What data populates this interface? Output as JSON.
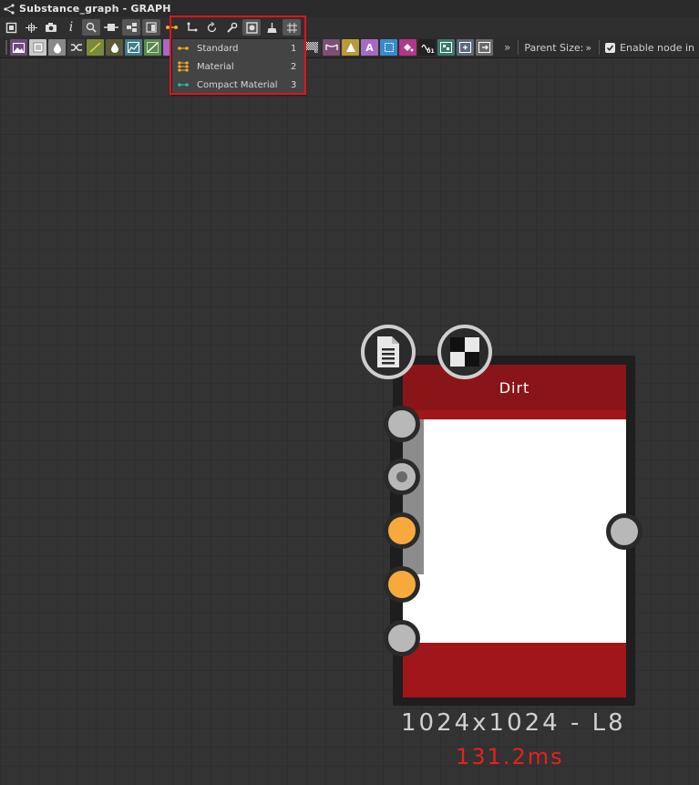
{
  "window": {
    "title": "Substance_graph - GRAPH"
  },
  "toolbar1": {
    "buttons": [
      {
        "name": "frame-all-icon"
      },
      {
        "name": "fit-view-icon"
      },
      {
        "name": "camera-icon"
      },
      {
        "name": "info-icon",
        "glyph": "i"
      },
      {
        "name": "search-icon"
      },
      {
        "name": "link-icon"
      },
      {
        "name": "align-icon"
      },
      {
        "name": "layout-icon"
      },
      {
        "name": "connector-style-icon"
      },
      {
        "name": "path-icon"
      },
      {
        "name": "refresh-icon"
      },
      {
        "name": "tools-icon"
      },
      {
        "name": "preview-icon"
      },
      {
        "name": "cleanup-icon"
      },
      {
        "name": "grid-snap-icon"
      }
    ]
  },
  "toolbar2": {
    "more_label": "»",
    "parent_size_label": "Parent Size:",
    "parent_size_chevron": "»",
    "enable_node_label": "Enable node in",
    "enable_node_checked": true,
    "text_button_label": "A",
    "bit_label": "01",
    "colors": {
      "image": "#6e4c7a",
      "uniform": "#c9c9c9",
      "gradient": "#7a8a3c",
      "levels": "#5a8a4a",
      "blend": "#3f7c8c",
      "text": "#a56ac3",
      "transform": "#3a8ac8",
      "warp": "#b2368c"
    }
  },
  "connector_menu": {
    "items": [
      {
        "label": "Standard",
        "shortcut": "1",
        "color": "#f0a823"
      },
      {
        "label": "Material",
        "shortcut": "2",
        "color": "#f0a823"
      },
      {
        "label": "Compact Material",
        "shortcut": "3",
        "color": "#2fb6a2"
      }
    ]
  },
  "node": {
    "title": "Dirt",
    "resolution": "1024x1024 - L8",
    "time": "131.2ms",
    "header_color": "#8a1519",
    "input_ports": [
      {
        "color": "grey"
      },
      {
        "color": "grey-dot"
      },
      {
        "color": "orange"
      },
      {
        "color": "orange"
      },
      {
        "color": "grey"
      }
    ],
    "output_ports": [
      {
        "color": "grey"
      }
    ]
  }
}
